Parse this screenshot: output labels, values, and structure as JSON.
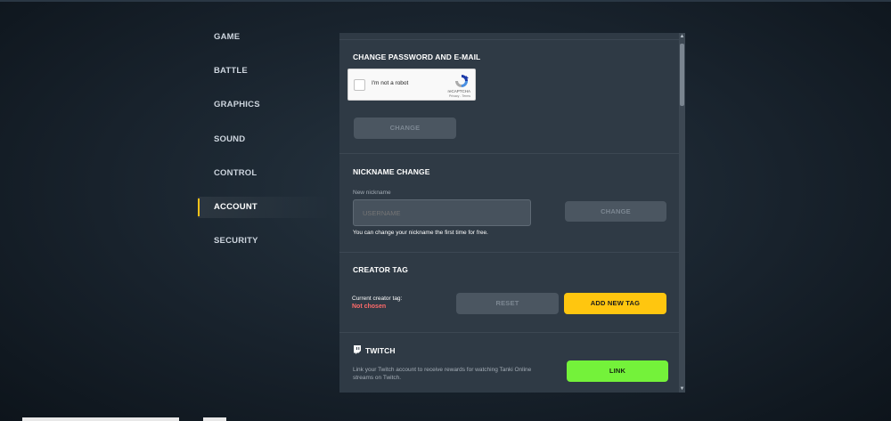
{
  "sidebar": {
    "items": [
      {
        "label": "GAME",
        "active": false
      },
      {
        "label": "BATTLE",
        "active": false
      },
      {
        "label": "GRAPHICS",
        "active": false
      },
      {
        "label": "SOUND",
        "active": false
      },
      {
        "label": "CONTROL",
        "active": false
      },
      {
        "label": "ACCOUNT",
        "active": true
      },
      {
        "label": "SECURITY",
        "active": false
      }
    ]
  },
  "password_section": {
    "title": "CHANGE PASSWORD AND E-MAIL",
    "recaptcha": {
      "label": "I'm not a robot",
      "brand": "reCAPTCHA",
      "terms": "Privacy - Terms"
    },
    "change_button": "CHANGE"
  },
  "nickname_section": {
    "title": "NICKNAME CHANGE",
    "field_label": "New nickname",
    "placeholder": "USERNAME",
    "change_button": "CHANGE",
    "hint": "You can change your nickname the first time for free."
  },
  "creator_tag_section": {
    "title": "CREATOR TAG",
    "current_label": "Current creator tag:",
    "current_value": "Not chosen",
    "reset_button": "RESET",
    "add_button": "ADD NEW TAG"
  },
  "twitch_section": {
    "title": "TWITCH",
    "description": "Link your Twitch account to receive rewards for watching Tanki Online streams on Twitch.",
    "link_button": "LINK"
  },
  "colors": {
    "accent_yellow": "#ffc60f",
    "accent_green": "#74f23a",
    "warning_red": "#ff6a6a",
    "panel_bg": "#2f3a45"
  }
}
